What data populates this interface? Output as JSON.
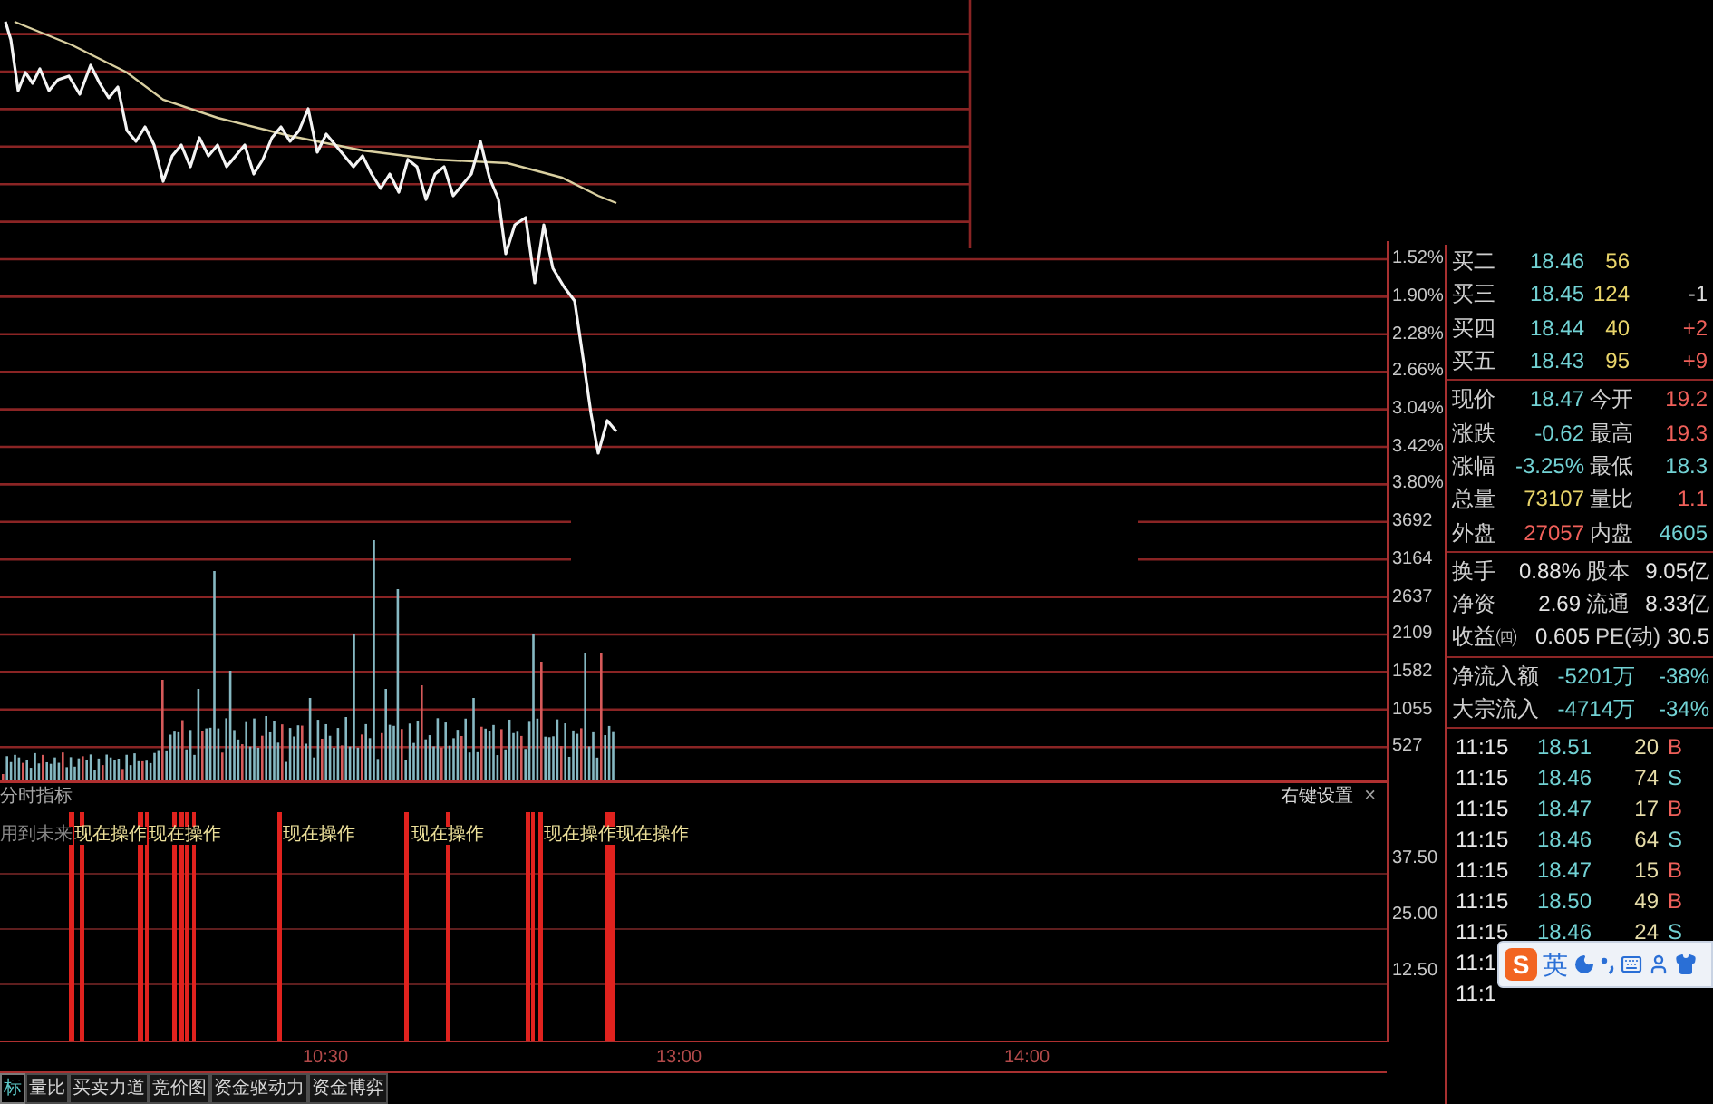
{
  "price_chart": {
    "axis_labels": [
      "1.52%",
      "1.90%",
      "2.28%",
      "2.66%",
      "3.04%",
      "3.42%",
      "3.80%"
    ]
  },
  "volume_chart": {
    "axis_labels": [
      "3692",
      "3164",
      "2637",
      "2109",
      "1582",
      "1055",
      "527"
    ]
  },
  "indicator_panel": {
    "title": "分时指标",
    "settings_label": "右键设置",
    "close_label": "×",
    "legend": "用到未来",
    "signals": [
      "现在操作",
      "现在操作",
      "现在操作",
      "现在操作",
      "现在操作",
      "现在操作"
    ],
    "axis_labels": [
      "37.50",
      "25.00",
      "12.50"
    ]
  },
  "time_axis": {
    "labels": [
      "10:30",
      "13:00",
      "14:00"
    ]
  },
  "bottom_tabs": [
    {
      "label": "标",
      "selected": true
    },
    {
      "label": "量比",
      "selected": false
    },
    {
      "label": "买卖力道",
      "selected": false
    },
    {
      "label": "竞价图",
      "selected": false
    },
    {
      "label": "资金驱动力",
      "selected": false
    },
    {
      "label": "资金博弈",
      "selected": false
    }
  ],
  "quote_panel": {
    "order_book": [
      {
        "label": "买二",
        "price": "18.46",
        "volume": "56"
      },
      {
        "label": "买三",
        "price": "18.45",
        "volume": "124",
        "change": {
          "value": "-1",
          "color": "#dcdcdc"
        }
      },
      {
        "label": "买四",
        "price": "18.44",
        "volume": "40",
        "change": {
          "value": "+2",
          "color": "#f0605a"
        }
      },
      {
        "label": "买五",
        "price": "18.43",
        "volume": "95",
        "change": {
          "value": "+9",
          "color": "#f0605a"
        }
      }
    ],
    "summary": [
      {
        "label": "现价",
        "value": "18.47",
        "color": "#72d2d4"
      },
      {
        "label": "今开",
        "value": "19.2",
        "color": "#f0605a"
      },
      {
        "label": "涨跌",
        "value": "-0.62",
        "color": "#72d2d4"
      },
      {
        "label": "最高",
        "value": "19.3",
        "color": "#f0605a"
      },
      {
        "label": "涨幅",
        "value": "-3.25%",
        "color": "#72d2d4"
      },
      {
        "label": "最低",
        "value": "18.3",
        "color": "#72d2d4"
      },
      {
        "label": "总量",
        "value": "73107",
        "color": "#e8d46a"
      },
      {
        "label": "量比",
        "value": "1.1",
        "color": "#f0605a"
      },
      {
        "label": "外盘",
        "value": "27057",
        "color": "#f0605a"
      },
      {
        "label": "内盘",
        "value": "4605",
        "color": "#72d2d4"
      }
    ],
    "stats": [
      {
        "label": "换手",
        "value": "0.88%"
      },
      {
        "label": "股本",
        "value": "9.05亿"
      },
      {
        "label": "净资",
        "value": "2.69"
      },
      {
        "label": "流通",
        "value": "8.33亿"
      },
      {
        "label": "收益㈣",
        "value": "0.605"
      },
      {
        "label": "PE(动)",
        "value": "30.5"
      }
    ],
    "fund_flow": [
      {
        "label": "净流入额",
        "value": "-5201万",
        "share": "-38%"
      },
      {
        "label": "大宗流入",
        "value": "-4714万",
        "share": "-34%"
      }
    ],
    "trades": [
      {
        "time": "11:15",
        "price": "18.51",
        "volume": "20",
        "side": "B",
        "kind": "buy"
      },
      {
        "time": "11:15",
        "price": "18.46",
        "volume": "74",
        "side": "S",
        "kind": "sell"
      },
      {
        "time": "11:15",
        "price": "18.47",
        "volume": "17",
        "side": "B",
        "kind": "buy"
      },
      {
        "time": "11:15",
        "price": "18.46",
        "volume": "64",
        "side": "S",
        "kind": "sell"
      },
      {
        "time": "11:15",
        "price": "18.47",
        "volume": "15",
        "side": "B",
        "kind": "buy"
      },
      {
        "time": "11:15",
        "price": "18.50",
        "volume": "49",
        "side": "B",
        "kind": "buy"
      },
      {
        "time": "11:15",
        "price": "18.46",
        "volume": "24",
        "side": "S",
        "kind": "sell"
      },
      {
        "time": "11:1"
      },
      {
        "time": "11:1"
      }
    ]
  },
  "ime_toolbar": {
    "logo": "S",
    "mode": "英"
  }
}
